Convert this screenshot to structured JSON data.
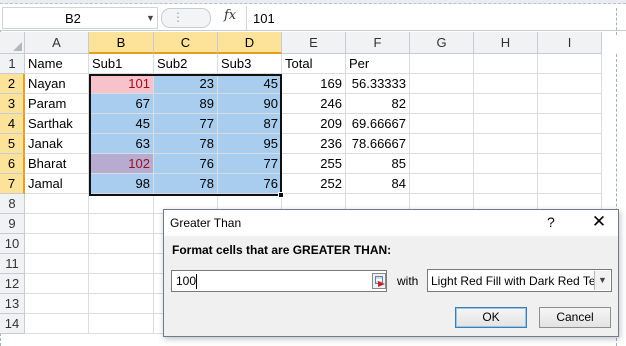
{
  "formula_bar": {
    "name_box": "B2",
    "fx_label": "fx",
    "content": "101"
  },
  "columns": [
    "A",
    "B",
    "C",
    "D",
    "E",
    "F",
    "G",
    "H",
    "I"
  ],
  "rows": [
    "1",
    "2",
    "3",
    "4",
    "5",
    "6",
    "7",
    "8",
    "9",
    "10",
    "11",
    "12",
    "13",
    "14"
  ],
  "sheet": {
    "header": [
      "Name",
      "Sub1",
      "Sub2",
      "Sub3",
      "Total",
      "Per"
    ],
    "data": [
      [
        "Nayan",
        "101",
        "23",
        "45",
        "169",
        "56.33333"
      ],
      [
        "Param",
        "67",
        "89",
        "90",
        "246",
        "82"
      ],
      [
        "Sarthak",
        "45",
        "77",
        "87",
        "209",
        "69.66667"
      ],
      [
        "Janak",
        "63",
        "78",
        "95",
        "236",
        "78.66667"
      ],
      [
        "Bharat",
        "102",
        "76",
        "77",
        "255",
        "85"
      ],
      [
        "Jamal",
        "98",
        "78",
        "76",
        "252",
        "84"
      ]
    ]
  },
  "colors": {
    "selection_fill": "#a9cdee",
    "highlight_fill": "#f7c2c9",
    "highlight_text": "#9b0f1a",
    "header_selected": "#fde29a"
  },
  "dialog": {
    "title": "Greater Than",
    "help": "?",
    "close": "✕",
    "label": "Format cells that are GREATER THAN:",
    "input_value": "100",
    "with_label": "with",
    "format_option": "Light Red Fill with Dark Red Text",
    "ok_label": "OK",
    "cancel_label": "Cancel"
  }
}
